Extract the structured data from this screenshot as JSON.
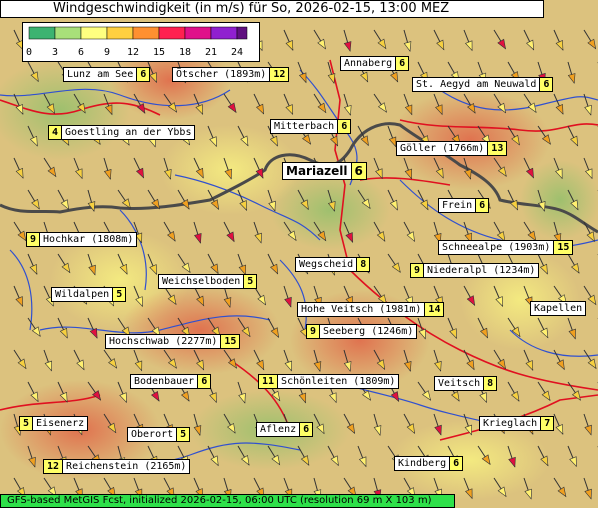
{
  "title": "Windgeschwindigkeit (in m/s) für So, 2026-02-15, 13:00 MEZ",
  "legend": {
    "ticks": [
      "0",
      "3",
      "6",
      "9",
      "12",
      "15",
      "18",
      "21",
      "24"
    ],
    "colors": [
      "#3cb371",
      "#a8e07a",
      "#ffff80",
      "#ffd040",
      "#ff9030",
      "#ff2050",
      "#e0108a",
      "#9020d0",
      "#601080"
    ]
  },
  "footer": "GFS-based MetGIS Fcst, initialized 2026-02-15, 06:00 UTC  (resolution 69 m X 103 m)",
  "labels": [
    {
      "id": "lunz-am-see",
      "name": "Lunz am See",
      "value": "6"
    },
    {
      "id": "oetscher",
      "name": "Ötscher (1893m)",
      "value": "12"
    },
    {
      "id": "annaberg",
      "name": "Annaberg",
      "value": "6"
    },
    {
      "id": "st-aegyd",
      "name": "St. Aegyd am Neuwald",
      "value": "6"
    },
    {
      "id": "goestling",
      "name": "Goestling an der Ybbs",
      "value": "4"
    },
    {
      "id": "mitterbach",
      "name": "Mitterbach",
      "value": "6"
    },
    {
      "id": "goeller",
      "name": "Göller (1766m)",
      "value": "13"
    },
    {
      "id": "mariazell",
      "name": "Mariazell",
      "value": "6"
    },
    {
      "id": "frein",
      "name": "Frein",
      "value": "6"
    },
    {
      "id": "hochkar",
      "name": "Hochkar (1808m)",
      "value": "9"
    },
    {
      "id": "schneealpe",
      "name": "Schneealpe (1903m)",
      "value": "15"
    },
    {
      "id": "wegscheid",
      "name": "Wegscheid",
      "value": "8"
    },
    {
      "id": "niederalpl",
      "name": "Niederalpl (1234m)",
      "value": "9"
    },
    {
      "id": "weichselboden",
      "name": "Weichselboden",
      "value": "5"
    },
    {
      "id": "wildalpen",
      "name": "Wildalpen",
      "value": "5"
    },
    {
      "id": "kapellen",
      "name": "Kapellen",
      "value": ""
    },
    {
      "id": "hohe-veitsch",
      "name": "Hohe Veitsch (1981m)",
      "value": "14"
    },
    {
      "id": "seeberg",
      "name": "Seeberg (1246m)",
      "value": "9"
    },
    {
      "id": "hochschwab",
      "name": "Hochschwab (2277m)",
      "value": "15"
    },
    {
      "id": "bodenbauer",
      "name": "Bodenbauer",
      "value": "6"
    },
    {
      "id": "schoenleiten",
      "name": "Schönleiten (1809m)",
      "value": "11"
    },
    {
      "id": "veitsch",
      "name": "Veitsch",
      "value": "8"
    },
    {
      "id": "eisenerz",
      "name": "Eisenerz",
      "value": "5"
    },
    {
      "id": "oberort",
      "name": "Oberort",
      "value": "5"
    },
    {
      "id": "aflenz",
      "name": "Aflenz",
      "value": "6"
    },
    {
      "id": "krieglach",
      "name": "Krieglach",
      "value": "7"
    },
    {
      "id": "reichenstein",
      "name": "Reichenstein (2165m)",
      "value": "12"
    },
    {
      "id": "kindberg",
      "name": "Kindberg",
      "value": "6"
    }
  ]
}
